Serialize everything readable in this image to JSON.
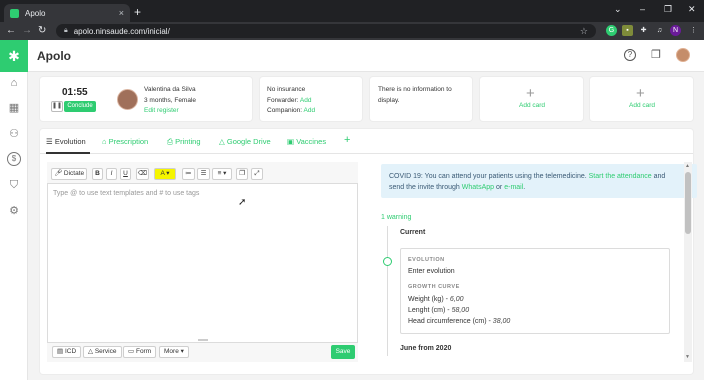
{
  "browser": {
    "tab_title": "Apolo",
    "tab_close": "×",
    "new_tab": "+",
    "url": "apolo.ninsaude.com/inicial/",
    "window_controls": [
      "⌄",
      "–",
      "❐",
      "✕"
    ],
    "profile_initial": "N"
  },
  "app": {
    "name": "Apolo",
    "brand_color": "#2ecc71"
  },
  "sidebar": {
    "icons": [
      "home-icon",
      "calendar-icon",
      "users-icon",
      "dollar-icon",
      "bag-icon",
      "gear-icon"
    ]
  },
  "consult": {
    "timer": "01:55",
    "conclude_label": "Conclude"
  },
  "patient": {
    "name": "Valentina da Silva",
    "info": "3 months, Female",
    "edit_label": "Edit register"
  },
  "insurance": {
    "line1": "No insurance",
    "forwarder_label": "Forwarder:",
    "forwarder_link": "Add",
    "companion_label": "Companion:",
    "companion_link": "Add"
  },
  "info_card": {
    "line1": "There is no information to",
    "line2": "display."
  },
  "add_cards": [
    {
      "plus": "+",
      "label": "Add card"
    },
    {
      "plus": "+",
      "label": "Add card"
    }
  ],
  "tabs": [
    {
      "icon": "☰",
      "label": "Evolution"
    },
    {
      "icon": "⌂",
      "label": "Prescription"
    },
    {
      "icon": "⎙",
      "label": "Printing"
    },
    {
      "icon": "△",
      "label": "Google Drive"
    },
    {
      "icon": "▣",
      "label": "Vaccines"
    },
    {
      "icon": "+",
      "label": ""
    }
  ],
  "editor": {
    "dictate_label": "Dictate",
    "bold": "B",
    "italic": "I",
    "underline": "U",
    "placeholder": "Type @ to use text templates and # to use tags",
    "footer_buttons": [
      "ICD",
      "Service",
      "Form",
      "More"
    ],
    "save_label": "Save"
  },
  "notice": {
    "text_1": "COVID 19: You can attend your patients using the telemedicine.",
    "link_1": "Start the attendance",
    "text_2": "and send the invite through",
    "link_2": "WhatsApp",
    "text_3": "or",
    "link_3": "e-mail",
    "text_4": "."
  },
  "timeline": {
    "warning": "1 warning",
    "current_label": "Current",
    "evolution_heading": "EVOLUTION",
    "evolution_text": "Enter evolution",
    "growth_heading": "GROWTH CURVE",
    "weight_label": "Weight (kg) - ",
    "weight_value": "6,00",
    "height_label": "Lenght (cm) - ",
    "height_value": "58,00",
    "head_label": "Head circumference (cm) - ",
    "head_value": "38,00",
    "past_label": "June from 2020"
  }
}
